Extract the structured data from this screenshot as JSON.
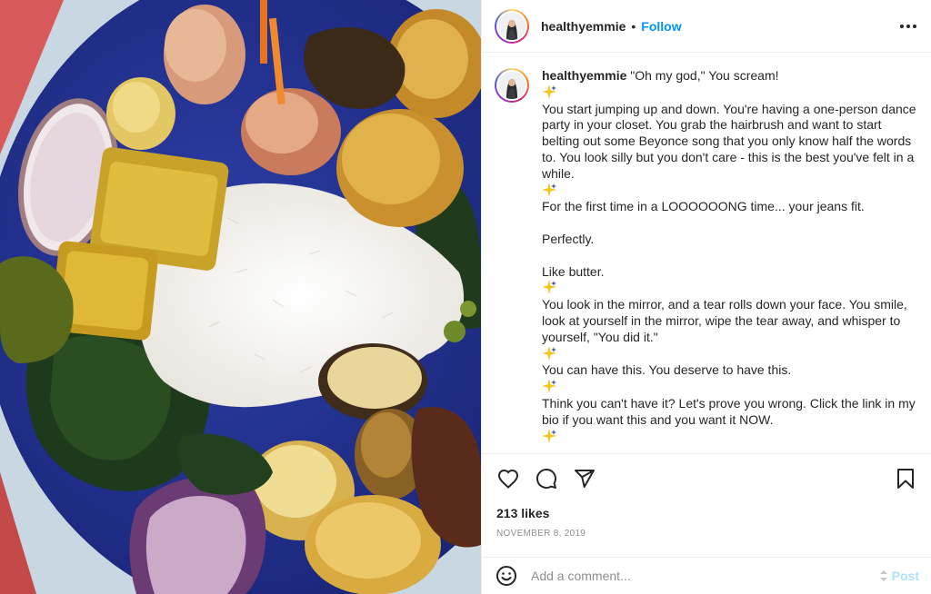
{
  "post": {
    "username": "healthyemmie",
    "follow_label": "Follow",
    "separator": "•"
  },
  "caption": {
    "username": "healthyemmie",
    "lines": [
      "\"Oh my god,\" You scream!",
      "[sparkle]",
      "You start jumping up and down. You're having a one-person dance party in your closet. You grab the hairbrush and want to start belting out some Beyonce song that you only know half the words to. You look silly but you don't care - this is the best you've felt in a while.",
      "[sparkle]",
      "For the first time in a LOOOOOONG time... your jeans fit.",
      "",
      "Perfectly.",
      "",
      "Like butter.",
      "[sparkle]",
      "You look in the mirror, and a tear rolls down your face. You smile, look at yourself in the mirror, wipe the tear away, and whisper to yourself, \"You did it.\"",
      "[sparkle]",
      "You can have this. You deserve to have this.",
      "[sparkle]",
      "Think you can't have it? Let's prove you wrong. Click the link in my bio if you want this and you want it NOW.",
      "[sparkle]"
    ],
    "icon": "sparkle-icon"
  },
  "engagement": {
    "likes": "213 likes",
    "date": "NOVEMBER 8, 2019"
  },
  "comment": {
    "placeholder": "Add a comment...",
    "post_label": "Post"
  },
  "colors": {
    "follow": "#0095f6",
    "post_disabled": "#b2dffc",
    "muted": "#8e8e8e",
    "text": "#262626",
    "divider": "#efefef"
  }
}
